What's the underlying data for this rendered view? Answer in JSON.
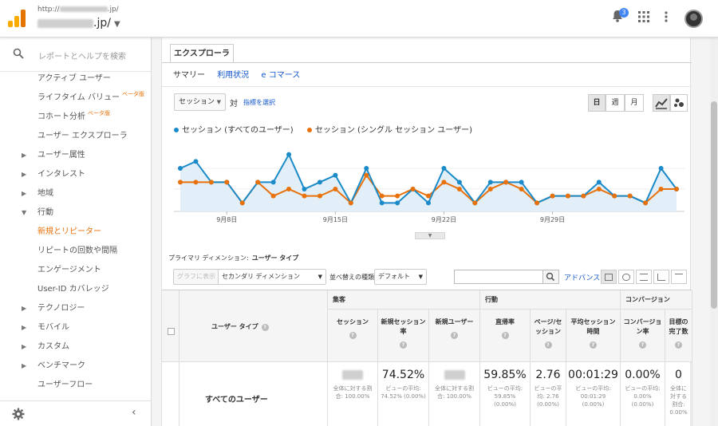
{
  "topbar": {
    "account_url": "http://",
    "account_url_suffix": ".jp/",
    "account_name_suffix": ".jp/",
    "notification_count": "3",
    "colors": {
      "logo_1": "#f9ab00",
      "logo_2": "#f9ab00",
      "logo_3": "#e37400"
    }
  },
  "sidebar": {
    "search_placeholder": "レポートとヘルプを検索",
    "items": [
      {
        "label": "アクティブ ユーザー",
        "arrow": "",
        "beta": ""
      },
      {
        "label": "ライフタイム バリュー",
        "arrow": "",
        "beta": "ベータ版"
      },
      {
        "label": "コホート分析",
        "arrow": "",
        "beta": "ベータ版"
      },
      {
        "label": "ユーザー エクスプローラ",
        "arrow": "",
        "beta": ""
      },
      {
        "label": "ユーザー属性",
        "arrow": "▶",
        "beta": ""
      },
      {
        "label": "インタレスト",
        "arrow": "▶",
        "beta": ""
      },
      {
        "label": "地域",
        "arrow": "▶",
        "beta": ""
      },
      {
        "label": "行動",
        "arrow": "▼",
        "beta": ""
      },
      {
        "label": "新規とリピーター",
        "arrow": "",
        "beta": "",
        "active": true
      },
      {
        "label": "リピートの回数や間隔",
        "arrow": "",
        "beta": ""
      },
      {
        "label": "エンゲージメント",
        "arrow": "",
        "beta": ""
      },
      {
        "label": "User-ID カバレッジ",
        "arrow": "",
        "beta": ""
      },
      {
        "label": "テクノロジー",
        "arrow": "▶",
        "beta": ""
      },
      {
        "label": "モバイル",
        "arrow": "▶",
        "beta": ""
      },
      {
        "label": "カスタム",
        "arrow": "▶",
        "beta": ""
      },
      {
        "label": "ベンチマーク",
        "arrow": "▶",
        "beta": ""
      },
      {
        "label": "ユーザーフロー",
        "arrow": "",
        "beta": ""
      }
    ],
    "collapse_icon": "chevron-left-icon"
  },
  "explorer": {
    "tab_label": "エクスプローラ",
    "subtabs": [
      "サマリー",
      "利用状況",
      "e コマース"
    ],
    "metric_select": "セッション",
    "vs_label": "対",
    "pick_metric": "指標を選択",
    "periods": [
      "日",
      "週",
      "月"
    ]
  },
  "chart_data": {
    "type": "line",
    "series": [
      {
        "name": "セッション (すべてのユーザー)",
        "color": "#1a8bc8",
        "values": [
          6,
          7,
          4,
          4,
          1,
          4,
          4,
          8,
          3,
          4,
          5,
          1,
          6,
          1,
          1,
          3,
          1,
          6,
          4,
          1,
          4,
          4,
          4,
          1,
          2,
          2,
          2,
          4,
          2,
          2,
          1,
          6,
          3
        ]
      },
      {
        "name": "セッション (シングル セッション ユーザー)",
        "color": "#e8710a",
        "values": [
          4,
          4,
          4,
          4,
          1,
          4,
          2,
          3,
          2,
          2,
          3,
          1,
          5,
          2,
          2,
          3,
          2,
          4,
          3,
          1,
          3,
          4,
          3,
          1,
          2,
          2,
          2,
          3,
          2,
          2,
          1,
          3,
          3
        ]
      }
    ],
    "x_ticks": [
      "9月8日",
      "9月15日",
      "9月22日",
      "9月29日"
    ],
    "ylim": [
      0,
      9
    ],
    "grid": true
  },
  "table_area": {
    "primary_dimension_label": "プライマリ ディメンション:",
    "primary_dimension_value": "ユーザー タイプ",
    "graph_button": "グラフに表示",
    "secondary_dimension": "セカンダリ ディメンション",
    "sort_label": "並べ替えの種類:",
    "sort_value": "デフォルト",
    "advanced": "アドバンス",
    "groups": [
      "集客",
      "行動",
      "コンバージョン"
    ],
    "dimension_header": "ユーザー タイプ",
    "columns": [
      "セッション",
      "新規セッション率",
      "新規ユーザー",
      "直帰率",
      "ページ/セッション",
      "平均セッション時間",
      "コンバージョン率",
      "目標の完了数"
    ],
    "row": {
      "name": "すべてのユーザー",
      "values": [
        "",
        "74.52%",
        "",
        "59.85%",
        "2.76",
        "00:01:29",
        "0.00%",
        "0"
      ],
      "subs": [
        "全体に対する割合: 100.00%",
        "ビューの平均: 74.52% (0.00%)",
        "全体に対する割合: 100.00%",
        "ビューの平均: 59.85% (0.00%)",
        "ビューの平均: 2.76 (0.00%)",
        "ビューの平均: 00:01:29 (0.00%)",
        "ビューの平均: 0.00% (0.00%)",
        "全体に対する割合: 0.00%"
      ]
    }
  }
}
